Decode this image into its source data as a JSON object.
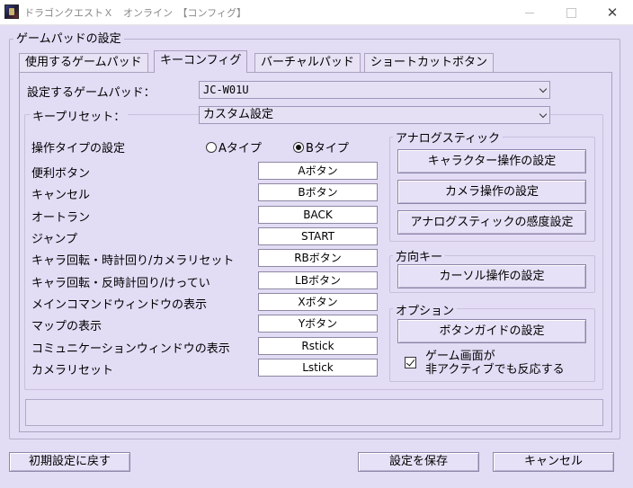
{
  "window": {
    "title": "ドラゴンクエストＸ　オンライン　【コンフィグ】",
    "close_glyph": "✕"
  },
  "group": {
    "title": "ゲームパッドの設定"
  },
  "tabs": [
    {
      "label": "使用するゲームパッド"
    },
    {
      "label": "キーコンフィグ"
    },
    {
      "label": "バーチャルパッド"
    },
    {
      "label": "ショートカットボタン"
    }
  ],
  "pad_select": {
    "label": "設定するゲームパッド：",
    "value": "JC-W01U"
  },
  "preset_select": {
    "label": "キープリセット：",
    "value": "カスタム設定"
  },
  "operation_type": {
    "label": "操作タイプの設定",
    "option_a": "Aタイプ",
    "option_b": "Bタイプ",
    "selected": "B"
  },
  "key_bindings": [
    {
      "label": "便利ボタン",
      "value": "Aボタン"
    },
    {
      "label": "キャンセル",
      "value": "Bボタン"
    },
    {
      "label": "オートラン",
      "value": "BACK"
    },
    {
      "label": "ジャンプ",
      "value": "START"
    },
    {
      "label": "キャラ回転・時計回り/カメラリセット",
      "value": "RBボタン"
    },
    {
      "label": "キャラ回転・反時計回り/けってい",
      "value": "LBボタン"
    },
    {
      "label": "メインコマンドウィンドウの表示",
      "value": "Xボタン"
    },
    {
      "label": "マップの表示",
      "value": "Yボタン"
    },
    {
      "label": "コミュニケーションウィンドウの表示",
      "value": "Rstick"
    },
    {
      "label": "カメラリセット",
      "value": "Lstick"
    }
  ],
  "analog": {
    "title": "アナログスティック",
    "btn_character": "キャラクター操作の設定",
    "btn_camera": "カメラ操作の設定",
    "btn_sensitivity": "アナログスティックの感度設定"
  },
  "direction": {
    "title": "方向キー",
    "btn_cursor": "カーソル操作の設定"
  },
  "options": {
    "title": "オプション",
    "btn_guide": "ボタンガイドの設定",
    "checkbox_line1": "ゲーム画面が",
    "checkbox_line2": "非アクティブでも反応する",
    "checkbox_checked": true
  },
  "footer": {
    "reset": "初期設定に戻す",
    "save": "設定を保存",
    "cancel": "キャンセル"
  }
}
